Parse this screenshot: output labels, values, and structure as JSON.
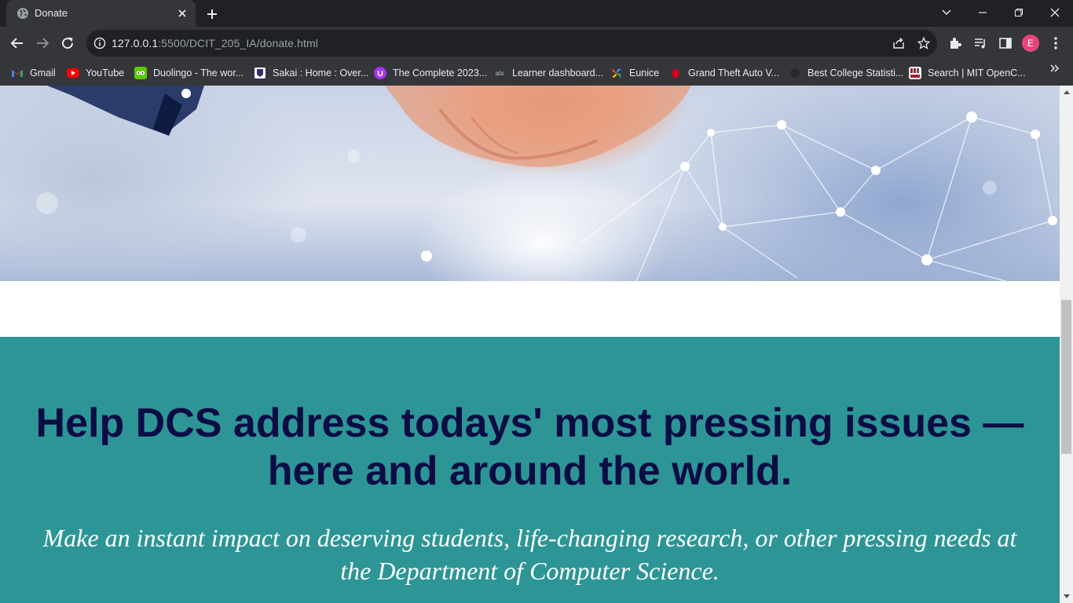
{
  "window": {
    "tab_title": "Donate",
    "controls": [
      "minimize",
      "maximize",
      "close"
    ]
  },
  "toolbar": {
    "url_host": "127.0.0.1",
    "url_rest": ":5500/DCIT_205_IA/donate.html",
    "avatar_letter": "E"
  },
  "bookmarks": [
    {
      "label": "Gmail",
      "icon": "gmail-icon",
      "color": "#ea4335"
    },
    {
      "label": "YouTube",
      "icon": "youtube-icon",
      "color": "#ff0000"
    },
    {
      "label": "Duolingo - The wor...",
      "icon": "duolingo-icon",
      "color": "#58cc02"
    },
    {
      "label": "Sakai : Home : Over...",
      "icon": "sakai-icon",
      "color": "#3b2a6b"
    },
    {
      "label": "The Complete 2023...",
      "icon": "udemy-icon",
      "color": "#a435f0"
    },
    {
      "label": "Learner dashboard...",
      "icon": "alx-icon",
      "color": "#111111"
    },
    {
      "label": "Eunice",
      "icon": "pinwheel-icon",
      "color": "#4285f4"
    },
    {
      "label": "Grand Theft Auto V...",
      "icon": "gta-icon",
      "color": "#d6001c"
    },
    {
      "label": "Best College Statisti...",
      "icon": "globe-icon",
      "color": "#202124"
    },
    {
      "label": "Search | MIT OpenC...",
      "icon": "mit-ocw-icon",
      "color": "#a31f34"
    }
  ],
  "page": {
    "headline": "Help DCS address todays' most pressing issues —here and around the world.",
    "subline": "Make an instant impact on deserving students, life-changing research, or other pressing needs at the Department of Computer Science.",
    "teal_color": "#2d9596",
    "headline_color": "#0b0c44"
  }
}
